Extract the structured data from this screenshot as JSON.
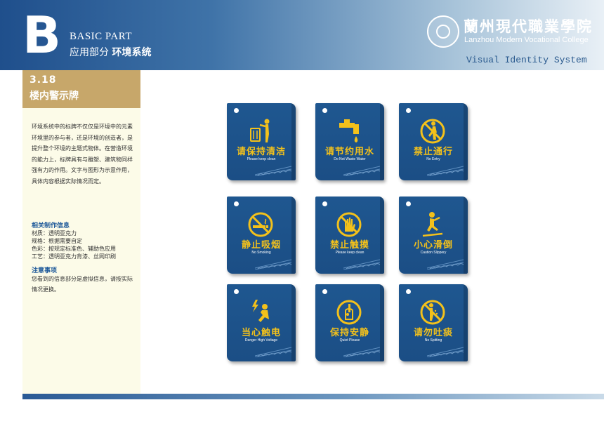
{
  "header": {
    "letter": "B",
    "basic_part": "BASIC PART",
    "section_cn": "应用部分",
    "section_sub": "环境系统",
    "school_cn": "蘭州現代職業學院",
    "school_en": "Lanzhou Modern Vocational College",
    "vis": "Visual Identity System"
  },
  "page": {
    "code": "3.18",
    "name": "楼内警示牌",
    "description": "环境系统中的标牌不仅仅是环境中的元素环境里的参与者，还是环境的创造者，是提升整个环境的主题式物体。在营造环境的能力上，标牌具有与雕塑、建筑物同样强有力的作用。文字与图形为示意作用，具体内容根据实际情况而定。",
    "info_title": "相关制作信息",
    "specs": [
      "材质：透明亚克力",
      "规格：根据需要自定",
      "色彩：按规定标准色、辅助色应用",
      "工艺：透明亚克力背漆、丝网印刷"
    ],
    "note_title": "注意事项",
    "note": "您看到的信息部分是虚拟信息，请按实际情况更换。"
  },
  "colors": {
    "sign_blue": "#1f5790",
    "sign_yellow": "#f3c11b",
    "gold": "#c7a76a"
  },
  "signs": [
    {
      "cn": "请保持清洁",
      "en": "Please keep clean",
      "icon": "trash-bin-icon"
    },
    {
      "cn": "请节约用水",
      "en": "Do Not Waste Water",
      "icon": "water-tap-icon"
    },
    {
      "cn": "禁止通行",
      "en": "No Entry",
      "icon": "no-entry-icon"
    },
    {
      "cn": "静止吸烟",
      "en": "No Smoking",
      "icon": "no-smoking-icon"
    },
    {
      "cn": "禁止触摸",
      "en": "Please keep clean",
      "icon": "no-touch-icon"
    },
    {
      "cn": "小心滑倒",
      "en": "Caution Slippery",
      "icon": "slip-icon"
    },
    {
      "cn": "当心触电",
      "en": "Danger High Voltage",
      "icon": "electric-shock-icon"
    },
    {
      "cn": "保持安静",
      "en": "Quiet Please",
      "icon": "quiet-icon"
    },
    {
      "cn": "请勿吐痰",
      "en": "No Spitting",
      "icon": "no-spitting-icon"
    }
  ]
}
